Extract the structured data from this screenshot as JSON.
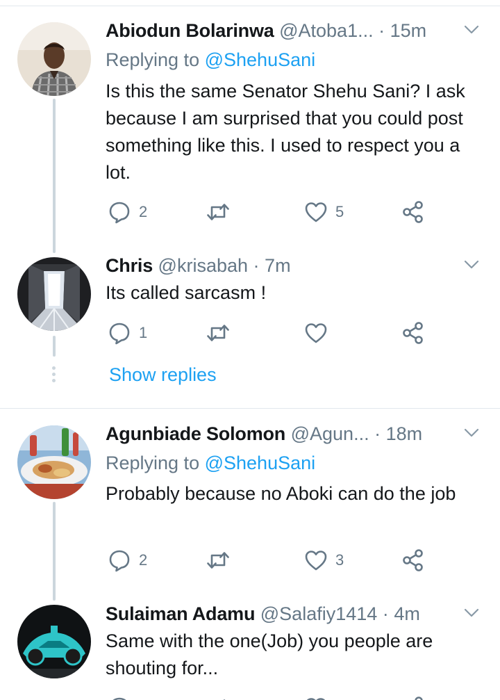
{
  "tweets": [
    {
      "name": "Abiodun Bolarinwa",
      "handle": "@Atoba1...",
      "dot": "·",
      "time": "15m",
      "replying_prefix": "Replying to",
      "replying_to": "@ShehuSani",
      "text": "Is this the same Senator Shehu Sani? I ask because I am surprised that you could post something like this.  I used to respect you a lot.",
      "replies": "2",
      "retweets": "",
      "likes": "5"
    },
    {
      "name": "Chris",
      "handle": "@krisabah",
      "dot": "·",
      "time": "7m",
      "text": "Its called sarcasm !",
      "replies": "1",
      "retweets": "",
      "likes": ""
    },
    {
      "name": "Agunbiade Solomon",
      "handle": "@Agun...",
      "dot": "·",
      "time": "18m",
      "replying_prefix": "Replying to",
      "replying_to": "@ShehuSani",
      "text": "Probably because no Aboki can do the job",
      "replies": "2",
      "retweets": "",
      "likes": "3"
    },
    {
      "name": "Sulaiman Adamu",
      "handle": "@Salafiy1414",
      "dot": "·",
      "time": "4m",
      "text": "Same with the one(Job) you people are shouting for..."
    }
  ],
  "show_replies": "Show replies",
  "icons": {
    "reply": "reply-icon",
    "retweet": "retweet-icon",
    "like": "heart-icon",
    "share": "share-icon",
    "more": "chevron-down-icon"
  },
  "colors": {
    "link": "#1da1f2",
    "muted": "#657786",
    "text": "#14171a",
    "divider": "#e1e8ed",
    "thread_line": "#ccd6dd"
  }
}
